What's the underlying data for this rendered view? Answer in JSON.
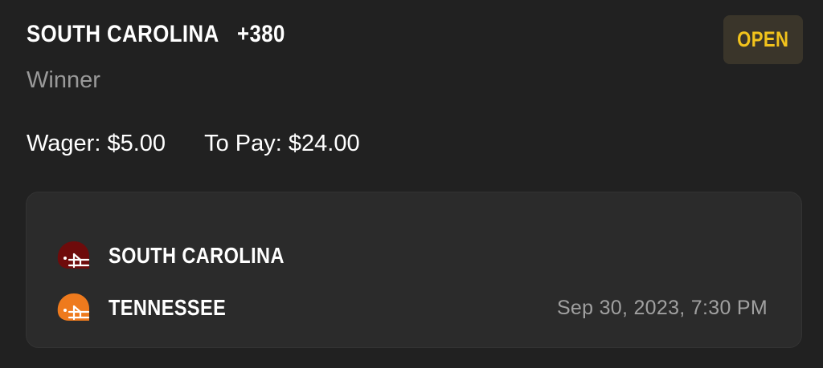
{
  "bet": {
    "selection": "SOUTH CAROLINA",
    "odds": "+380",
    "market": "Winner",
    "status": "OPEN",
    "wager_label": "Wager:",
    "wager_value": "$5.00",
    "topay_label": "To Pay:",
    "topay_value": "$24.00"
  },
  "game": {
    "teams": [
      {
        "name": "SOUTH CAROLINA",
        "icon": "helmet-icon",
        "color": "#6e0b0b"
      },
      {
        "name": "TENNESSEE",
        "icon": "helmet-icon",
        "color": "#ee7a1d"
      }
    ],
    "datetime": "Sep 30, 2023, 7:30 PM"
  },
  "colors": {
    "background": "#212121",
    "panel": "#2b2b2b",
    "status_text": "#f2c31c",
    "status_bg": "#3a352a"
  }
}
